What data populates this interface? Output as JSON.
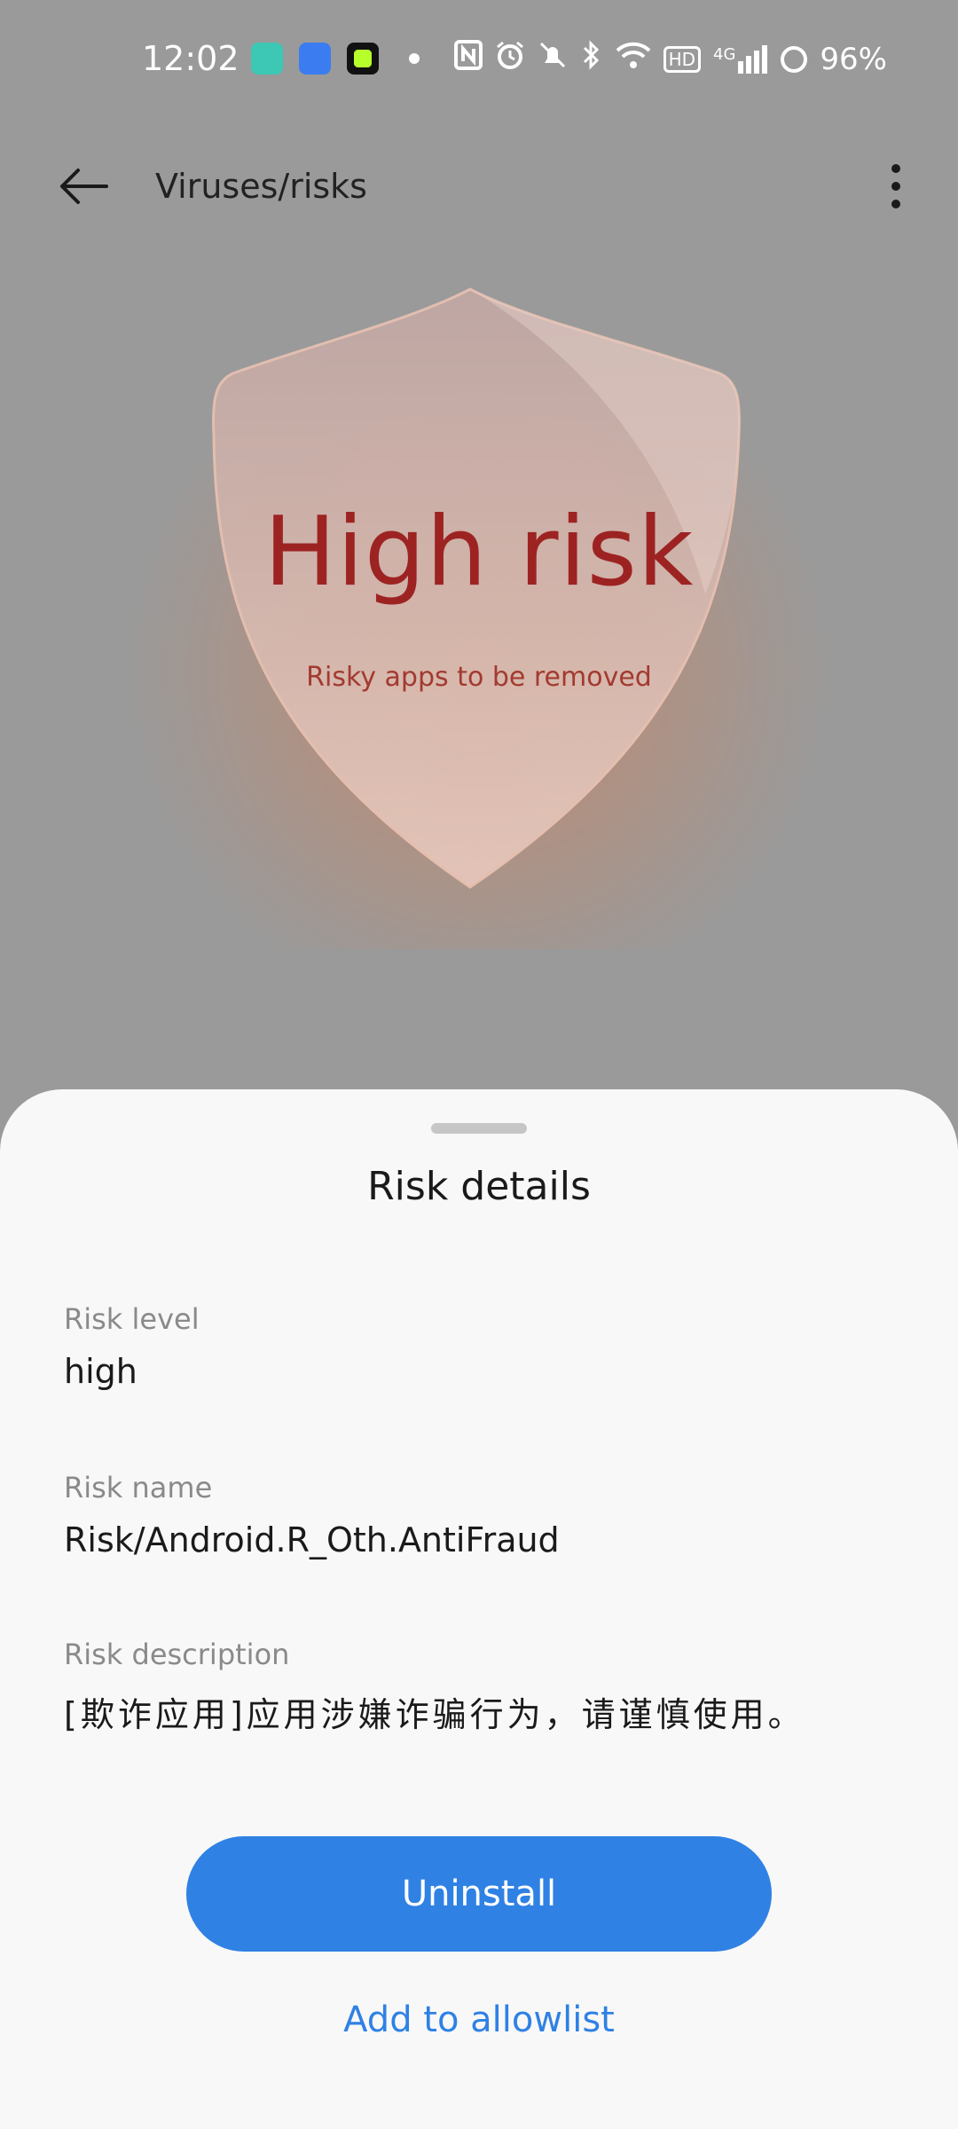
{
  "status_bar": {
    "time": "12:02",
    "battery": "96%",
    "network": "4G",
    "hd_label": "HD"
  },
  "header": {
    "title": "Viruses/risks"
  },
  "hero": {
    "title": "High risk",
    "subtitle": "Risky apps to be removed",
    "accent_color": "#9d2323"
  },
  "sheet": {
    "title": "Risk details",
    "fields": [
      {
        "label": "Risk level",
        "value": "high"
      },
      {
        "label": "Risk name",
        "value": "Risk/Android.R_Oth.AntiFraud"
      },
      {
        "label": "Risk description",
        "value": "[欺诈应用]应用涉嫌诈骗行为，请谨慎使用。"
      }
    ],
    "primary_button": "Uninstall",
    "secondary_link": "Add to allowlist",
    "primary_color": "#2f81e4"
  }
}
